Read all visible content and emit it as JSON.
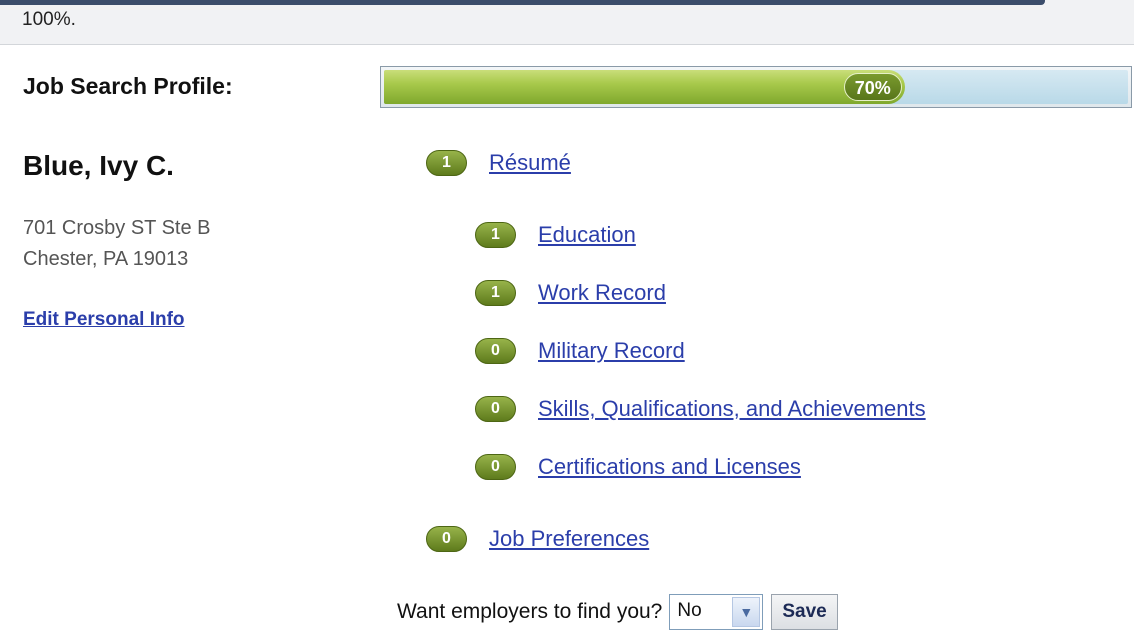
{
  "header": {
    "zoom_text": "100%."
  },
  "profile": {
    "label": "Job Search Profile:",
    "progress_percent": 70,
    "progress_text": "70%"
  },
  "person": {
    "name": "Blue, Ivy C.",
    "address_line1": "701 Crosby ST Ste B",
    "address_line2": "Chester, PA 19013",
    "edit_link": "Edit Personal Info"
  },
  "sections": {
    "resume": {
      "count": "1",
      "label": "Résumé"
    },
    "education": {
      "count": "1",
      "label": "Education"
    },
    "work_record": {
      "count": "1",
      "label": "Work Record"
    },
    "military_record": {
      "count": "0",
      "label": "Military Record"
    },
    "skills": {
      "count": "0",
      "label": "Skills, Qualifications, and Achievements"
    },
    "certifications": {
      "count": "0",
      "label": "Certifications and Licenses"
    },
    "job_preferences": {
      "count": "0",
      "label": "Job Preferences"
    }
  },
  "find_me": {
    "label": "Want employers to find you?",
    "selected_value": "No",
    "save_label": "Save"
  },
  "colors": {
    "link": "#2b3eaa",
    "badge_green": "#6f8d25",
    "progress_fill": "#a8c94b",
    "progress_track": "#b9d9e8"
  }
}
